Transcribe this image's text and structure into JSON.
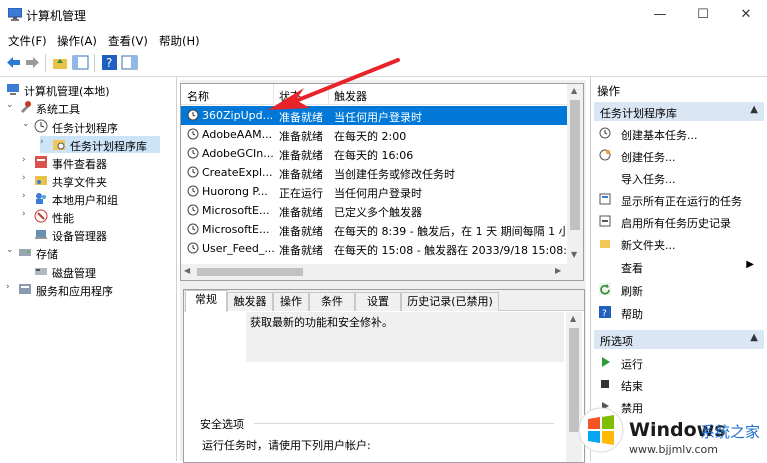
{
  "window": {
    "title": "计算机管理",
    "minimize": "—",
    "maximize": "☐",
    "close": "✕"
  },
  "menu": [
    "文件(F)",
    "操作(A)",
    "查看(V)",
    "帮助(H)"
  ],
  "tree": [
    {
      "label": "计算机管理(本地)",
      "exp": "",
      "icon": "computer-icon"
    },
    {
      "label": "系统工具",
      "exp": "⌄",
      "icon": "tools-icon"
    },
    {
      "label": "任务计划程序",
      "exp": "⌄",
      "icon": "clock-icon"
    },
    {
      "label": "任务计划程序库",
      "exp": "›",
      "icon": "folder-icon"
    },
    {
      "label": "事件查看器",
      "exp": "›",
      "icon": "event-viewer-icon"
    },
    {
      "label": "共享文件夹",
      "exp": "›",
      "icon": "shared-folder-icon"
    },
    {
      "label": "本地用户和组",
      "exp": "›",
      "icon": "users-icon"
    },
    {
      "label": "性能",
      "exp": "›",
      "icon": "performance-icon"
    },
    {
      "label": "设备管理器",
      "exp": "",
      "icon": "device-manager-icon"
    },
    {
      "label": "存储",
      "exp": "⌄",
      "icon": "storage-icon"
    },
    {
      "label": "磁盘管理",
      "exp": "",
      "icon": "disk-icon"
    },
    {
      "label": "服务和应用程序",
      "exp": "›",
      "icon": "services-icon"
    }
  ],
  "tasks": {
    "columns": [
      "名称",
      "状态",
      "触发器"
    ],
    "rows": [
      {
        "name": "360ZipUpd...",
        "status": "准备就绪",
        "trigger": "当任何用户登录时"
      },
      {
        "name": "AdobeAAM...",
        "status": "准备就绪",
        "trigger": "在每天的 2:00"
      },
      {
        "name": "AdobeGCIn...",
        "status": "准备就绪",
        "trigger": "在每天的 16:06"
      },
      {
        "name": "CreateExpl...",
        "status": "准备就绪",
        "trigger": "当创建任务或修改任务时"
      },
      {
        "name": "Huorong P...",
        "status": "正在运行",
        "trigger": "当任何用户登录时"
      },
      {
        "name": "MicrosoftE...",
        "status": "准备就绪",
        "trigger": "已定义多个触发器"
      },
      {
        "name": "MicrosoftE...",
        "status": "准备就绪",
        "trigger": "在每天的 8:39 - 触发后，在 1 天 期间每隔 1 小"
      },
      {
        "name": "User_Feed_...",
        "status": "准备就绪",
        "trigger": "在每天的 15:08 - 触发器在 2033/9/18 15:08:5"
      }
    ]
  },
  "details": {
    "tabs": [
      "常规",
      "触发器",
      "操作",
      "条件",
      "设置",
      "历史记录(已禁用)"
    ],
    "description": "获取最新的功能和安全修补。",
    "security_title": "安全选项",
    "security_text": "运行任务时，请使用下列用户帐户:"
  },
  "actions": {
    "header": "操作",
    "group1": "任务计划程序库",
    "items1": [
      {
        "label": "创建基本任务...",
        "icon": "create-basic-task-icon"
      },
      {
        "label": "创建任务...",
        "icon": "create-task-icon"
      },
      {
        "label": "导入任务...",
        "icon": ""
      },
      {
        "label": "显示所有正在运行的任务",
        "icon": "running-tasks-icon"
      },
      {
        "label": "启用所有任务历史记录",
        "icon": "history-icon"
      },
      {
        "label": "新文件夹...",
        "icon": "new-folder-icon"
      },
      {
        "label": "查看",
        "icon": "",
        "submenu": "▶"
      },
      {
        "label": "刷新",
        "icon": "refresh-icon"
      },
      {
        "label": "帮助",
        "icon": "help-icon"
      }
    ],
    "group2": "所选项",
    "items2": [
      {
        "label": "运行",
        "icon": "run-icon"
      },
      {
        "label": "结束",
        "icon": "stop-icon"
      },
      {
        "label": "禁用",
        "icon": "disable-icon"
      }
    ],
    "collapse_caret": "▲"
  },
  "watermark": {
    "brand": "Windows",
    "suffix": "系统之家",
    "url": "www.bjjmlv.com"
  },
  "colors": {
    "selection": "#0078d7",
    "group_bg": "#dbe6f4",
    "arrow": "#e8232a"
  }
}
